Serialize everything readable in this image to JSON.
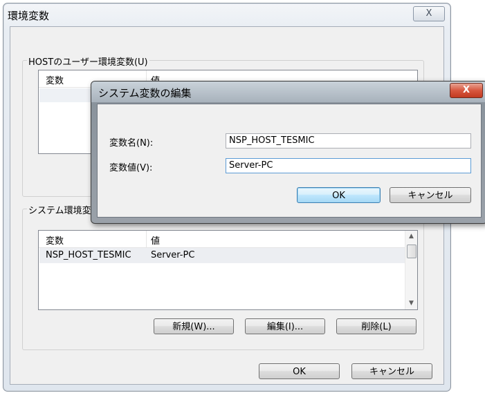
{
  "main_window": {
    "title": "環境変数",
    "close_label": "X",
    "user_group": {
      "legend": "HOSTのユーザー環境変数(U)",
      "col_variable": "変数",
      "col_value": "値"
    },
    "system_group": {
      "legend": "システム環境変数(S)",
      "col_variable": "変数",
      "col_value": "値",
      "rows": [
        {
          "variable": "NSP_HOST_TESMIC",
          "value": "Server-PC"
        }
      ],
      "new_button": "新規(W)...",
      "edit_button": "編集(I)...",
      "delete_button": "削除(L)"
    },
    "ok_button": "OK",
    "cancel_button": "キャンセル"
  },
  "edit_dialog": {
    "title": "システム変数の編集",
    "close_label": "X",
    "name_label": "変数名(N):",
    "name_value": "NSP_HOST_TESMIC",
    "value_label": "変数値(V):",
    "value_value": "Server-PC",
    "ok_button": "OK",
    "cancel_button": "キャンセル"
  }
}
